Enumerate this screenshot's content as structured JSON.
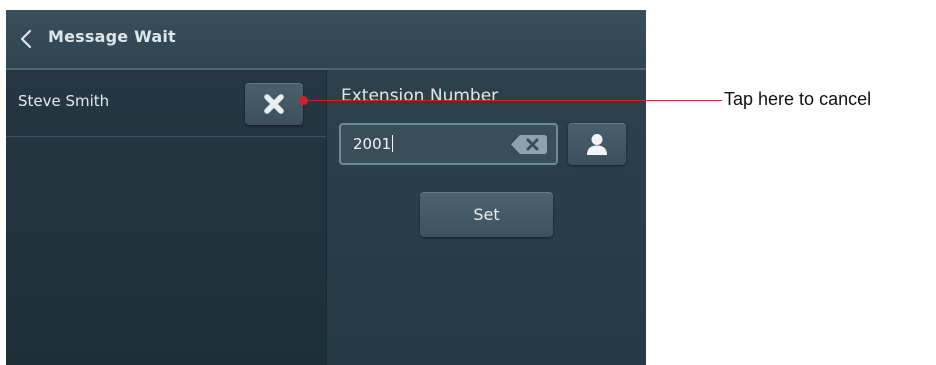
{
  "header": {
    "title": "Message Wait",
    "back_icon": "chevron-left-icon"
  },
  "list": {
    "items": [
      {
        "name": "Steve Smith",
        "action_icon": "close-icon"
      }
    ]
  },
  "form": {
    "extension_label": "Extension Number",
    "extension_value": "2001",
    "clear_icon": "backspace-icon",
    "contact_icon": "person-icon",
    "set_label": "Set"
  },
  "annotation": {
    "text": "Tap here to cancel",
    "color": "#d2202a"
  },
  "colors": {
    "panel_bg": "#243742",
    "titlebar_bg": "#3a4f5c",
    "button_bg": "#4b606d",
    "text": "#e3e9ec"
  }
}
